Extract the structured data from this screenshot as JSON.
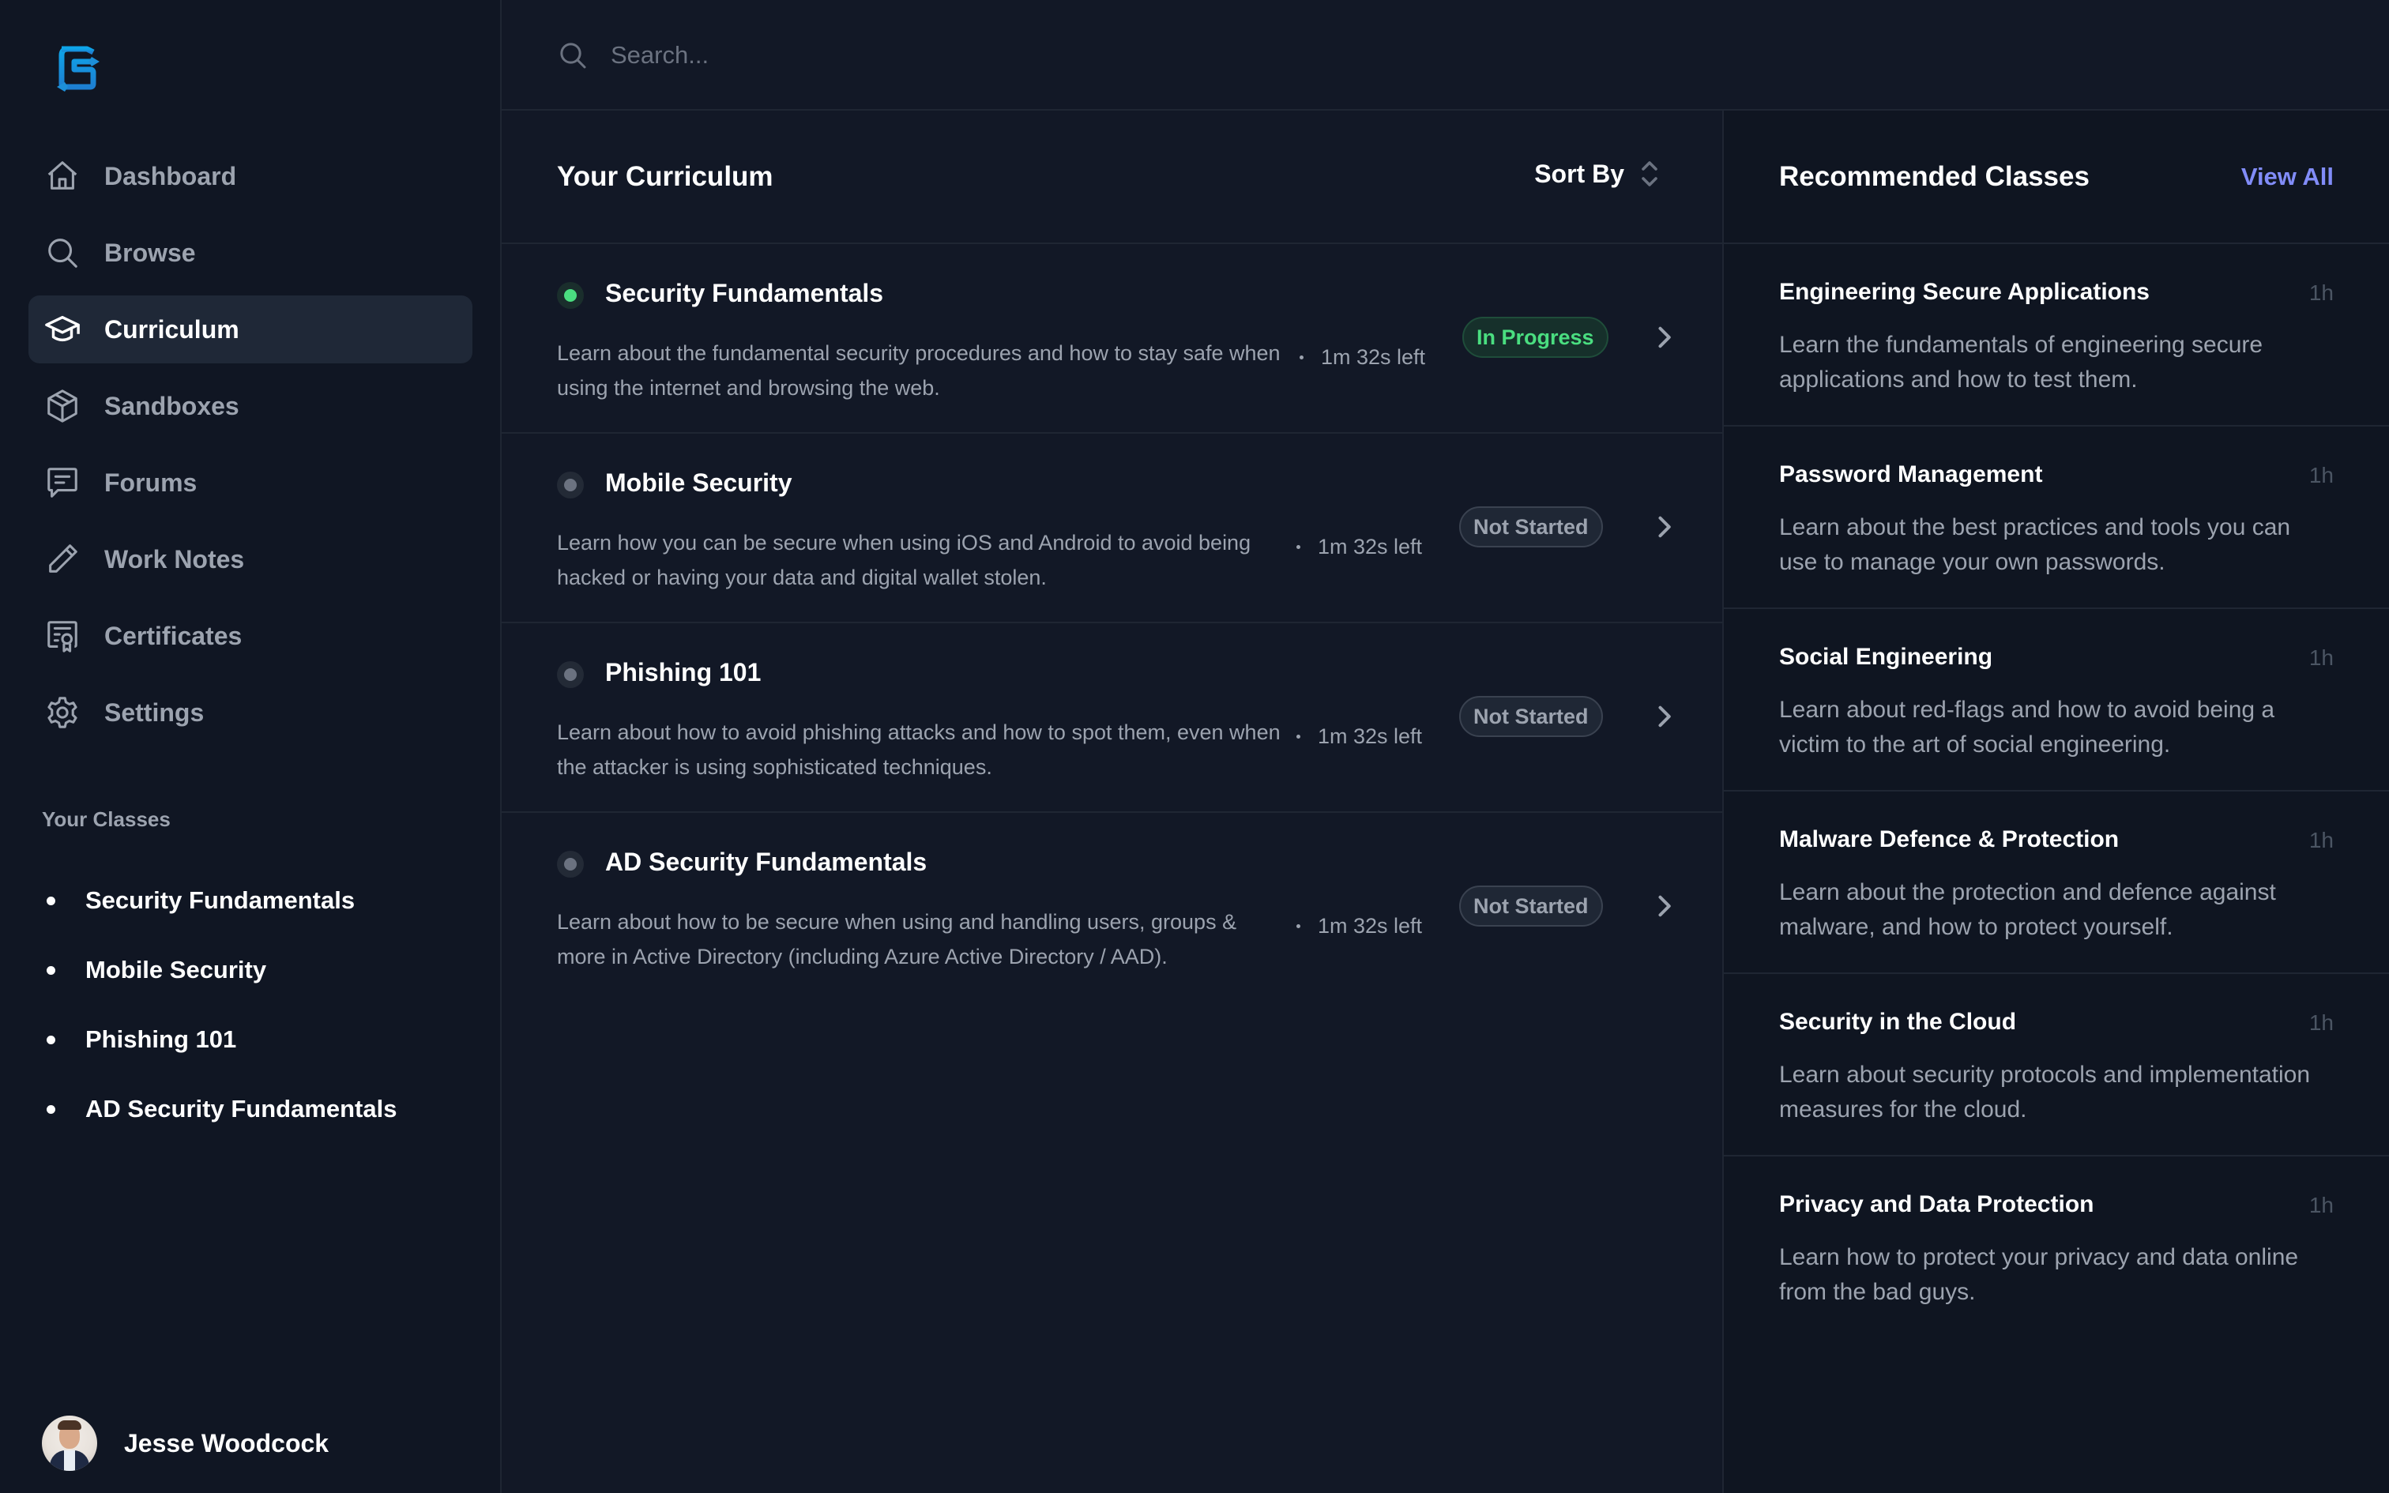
{
  "colors": {
    "accent": "#818cf8",
    "in_progress": "#4ade80",
    "logo": "#1e9be0"
  },
  "sidebar": {
    "logo": "logo-icon",
    "nav": [
      {
        "label": "Dashboard",
        "icon": "home-icon",
        "active": false
      },
      {
        "label": "Browse",
        "icon": "search-icon",
        "active": false
      },
      {
        "label": "Curriculum",
        "icon": "graduation-cap-icon",
        "active": true
      },
      {
        "label": "Sandboxes",
        "icon": "cube-icon",
        "active": false
      },
      {
        "label": "Forums",
        "icon": "chat-icon",
        "active": false
      },
      {
        "label": "Work Notes",
        "icon": "pencil-icon",
        "active": false
      },
      {
        "label": "Certificates",
        "icon": "certificate-icon",
        "active": false
      },
      {
        "label": "Settings",
        "icon": "gear-icon",
        "active": false
      }
    ],
    "classes_heading": "Your Classes",
    "classes": [
      "Security Fundamentals",
      "Mobile Security",
      "Phishing 101",
      "AD Security Fundamentals"
    ],
    "user": {
      "name": "Jesse Woodcock"
    }
  },
  "search": {
    "placeholder": "Search...",
    "value": ""
  },
  "curriculum": {
    "title": "Your Curriculum",
    "sort_label": "Sort By",
    "items": [
      {
        "title": "Security Fundamentals",
        "description": "Learn about the fundamental security procedures and how to stay safe when using the internet and browsing the web.",
        "time_left": "1m 32s left",
        "status": "In Progress",
        "status_key": "in-progress"
      },
      {
        "title": "Mobile Security",
        "description": "Learn how you can be secure when using iOS and Android to avoid being hacked or having your data and digital wallet stolen.",
        "time_left": "1m 32s left",
        "status": "Not Started",
        "status_key": "not-started"
      },
      {
        "title": "Phishing 101",
        "description": "Learn about how to avoid phishing attacks and how to spot them, even when the attacker is using sophisticated techniques.",
        "time_left": "1m 32s left",
        "status": "Not Started",
        "status_key": "not-started"
      },
      {
        "title": "AD Security Fundamentals",
        "description": "Learn about how to be secure when using and handling users, groups & more in Active Directory (including Azure Active Directory / AAD).",
        "time_left": "1m 32s left",
        "status": "Not Started",
        "status_key": "not-started"
      }
    ]
  },
  "recommended": {
    "title": "Recommended Classes",
    "view_all": "View All",
    "items": [
      {
        "name": "Engineering Secure Applications",
        "duration": "1h",
        "description": "Learn the fundamentals of engineering secure applications and how to test them."
      },
      {
        "name": "Password Management",
        "duration": "1h",
        "description": "Learn about the best practices and tools you can use to manage your own passwords."
      },
      {
        "name": "Social Engineering",
        "duration": "1h",
        "description": "Learn about red-flags and how to avoid being a victim to the art of social engineering."
      },
      {
        "name": "Malware Defence & Protection",
        "duration": "1h",
        "description": "Learn about the protection and defence against malware, and how to protect yourself."
      },
      {
        "name": "Security in the Cloud",
        "duration": "1h",
        "description": "Learn about security protocols and implementation measures for the cloud."
      },
      {
        "name": "Privacy and Data Protection",
        "duration": "1h",
        "description": "Learn how to protect your privacy and data online from the bad guys."
      }
    ]
  }
}
